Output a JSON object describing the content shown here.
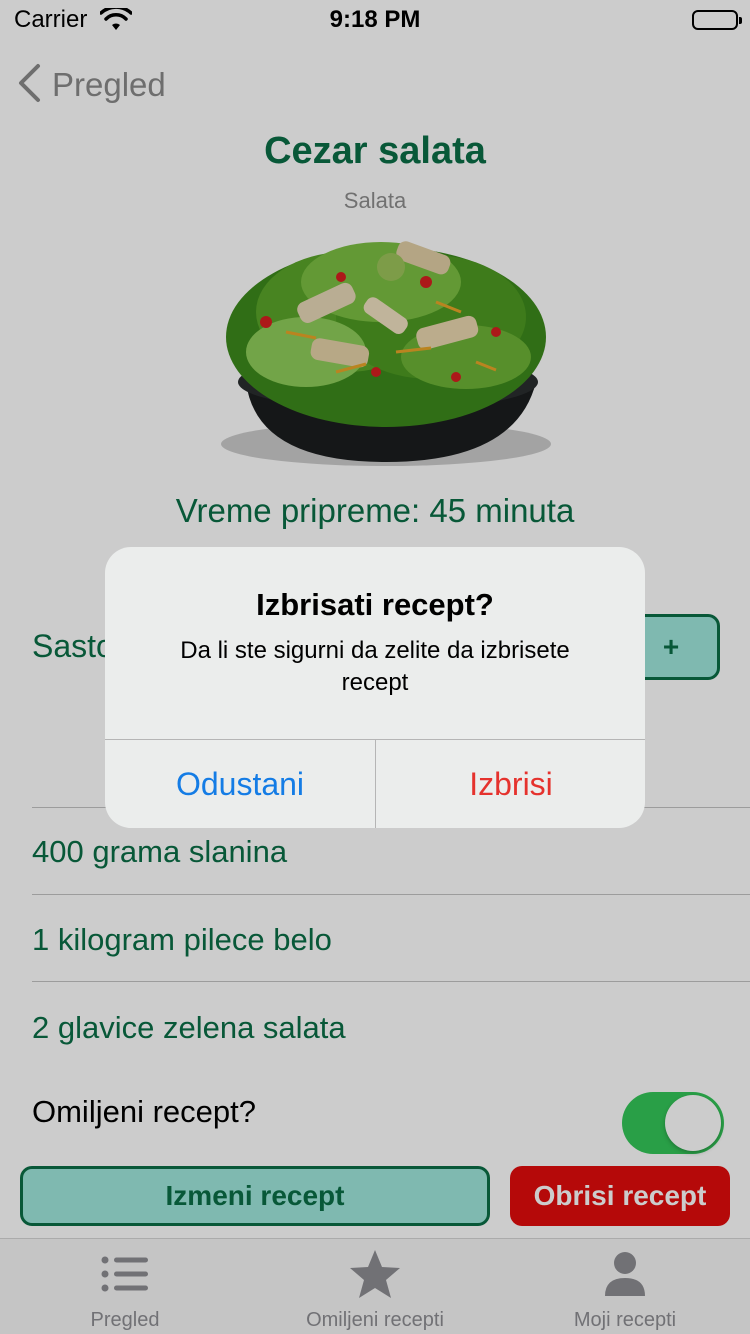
{
  "status_bar": {
    "carrier": "Carrier",
    "time": "9:18 PM"
  },
  "nav": {
    "back_label": "Pregled"
  },
  "recipe": {
    "title": "Cezar salata",
    "category": "Salata",
    "prep_time": "Vreme pripreme: 45 minuta",
    "ingredients_label": "Sastojci",
    "add_button": "+",
    "ingredients": [
      "400 grama slanina",
      "1 kilogram pilece belo",
      "2 glavice zelena salata"
    ],
    "favorite_label": "Omiljeni recept?",
    "favorite": true,
    "edit_button": "Izmeni recept",
    "delete_button": "Obrisi recept"
  },
  "alert": {
    "title": "Izbrisati recept?",
    "message": "Da li ste sigurni da zelite da izbrisete recept",
    "cancel": "Odustani",
    "confirm": "Izbrisi"
  },
  "tabbar": {
    "items": [
      {
        "label": "Pregled",
        "icon": "list-icon"
      },
      {
        "label": "Omiljeni recepti",
        "icon": "star-icon"
      },
      {
        "label": "Moji recepti",
        "icon": "person-icon"
      }
    ]
  },
  "colors": {
    "primary": "#0a6e46",
    "accent": "#9fe8dc",
    "danger": "#e30c0c",
    "toggle_on": "#34c759"
  }
}
